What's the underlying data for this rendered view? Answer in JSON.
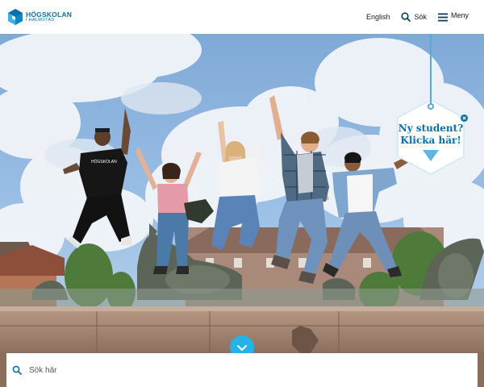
{
  "header": {
    "logo": {
      "line1": "HÖGSKOLAN",
      "line2": "I HALMSTAD"
    },
    "language_link": "English",
    "search_label": "Sök",
    "menu_label": "Meny"
  },
  "promo": {
    "line1": "Ny student?",
    "line2": "Klicka här!"
  },
  "hero": {
    "shirt_text": "HÖGSKOLAN"
  },
  "search": {
    "placeholder": "Sök här"
  },
  "colors": {
    "brand_blue": "#0a6fa8",
    "accent_cyan": "#24b3e6",
    "promo_border": "#5aa8d6"
  },
  "icons": [
    "logo-mark-icon",
    "search-icon",
    "menu-icon",
    "close-icon",
    "chevron-down-icon",
    "arrow-down-icon"
  ]
}
